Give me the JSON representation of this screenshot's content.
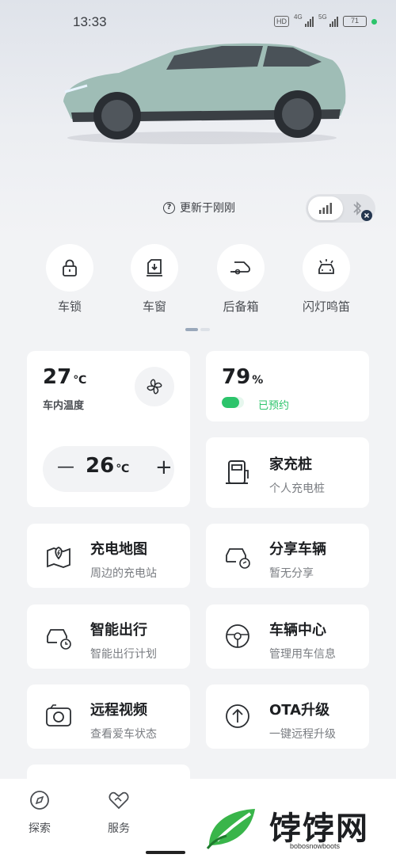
{
  "status_bar": {
    "time": "13:33",
    "hd": "HD",
    "net1": "4G",
    "net2": "5G",
    "battery": "71"
  },
  "header": {
    "update_text": "更新于刚刚"
  },
  "quick_actions": [
    {
      "label": "车锁",
      "icon": "lock-icon"
    },
    {
      "label": "车窗",
      "icon": "window-icon"
    },
    {
      "label": "后备箱",
      "icon": "trunk-icon"
    },
    {
      "label": "闪灯鸣笛",
      "icon": "flash-horn-icon"
    }
  ],
  "climate": {
    "inside_temp": "27",
    "inside_unit": "℃",
    "inside_label": "车内温度",
    "set_temp": "26",
    "set_unit": "℃",
    "minus": "—",
    "plus": "+"
  },
  "battery_card": {
    "percent": "79",
    "unit": "%",
    "status": "已预约",
    "level_fraction": 0.79
  },
  "tiles": {
    "home_charger": {
      "title": "家充桩",
      "sub": "个人充电桩"
    },
    "charge_map": {
      "title": "充电地图",
      "sub": "周边的充电站"
    },
    "share_vehicle": {
      "title": "分享车辆",
      "sub": "暂无分享"
    },
    "smart_trip": {
      "title": "智能出行",
      "sub": "智能出行计划"
    },
    "vehicle_center": {
      "title": "车辆中心",
      "sub": "管理用车信息"
    },
    "remote_video": {
      "title": "远程视频",
      "sub": "查看爱车状态"
    },
    "ota": {
      "title": "OTA升级",
      "sub": "一键远程升级"
    }
  },
  "tabbar": [
    {
      "label": "探索",
      "icon": "explore-icon"
    },
    {
      "label": "服务",
      "icon": "service-icon"
    }
  ],
  "watermark": {
    "text": "饽饽网",
    "sub": "bobosnowboots"
  },
  "colors": {
    "accent_green": "#2cc46b",
    "card_bg": "#ffffff",
    "page_bg": "#f2f3f5",
    "car_body": "#9fbdb6"
  }
}
